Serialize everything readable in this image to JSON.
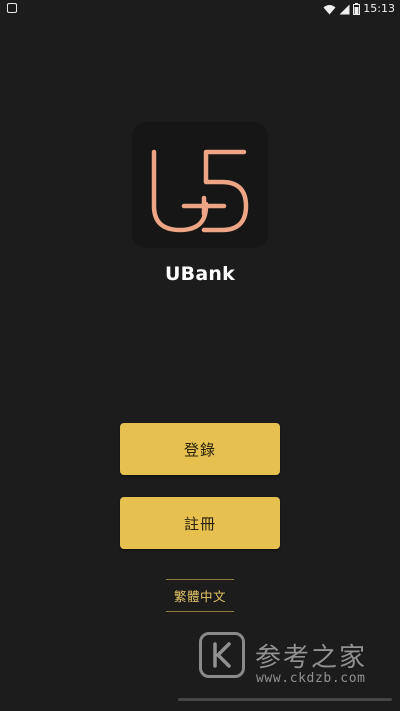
{
  "status_bar": {
    "time": "15:13",
    "icons": [
      "notification-icon",
      "wifi-icon",
      "cellular-signal-icon",
      "battery-icon"
    ]
  },
  "app": {
    "name": "UBank",
    "logo_color": "#eda585",
    "logo_icon": "ubank-logo"
  },
  "actions": {
    "login_label": "登錄",
    "register_label": "註冊",
    "language_label": "繁體中文",
    "button_color": "#e6c14f"
  },
  "watermark": {
    "title": "参考之家",
    "url": "www.ckdzb.com",
    "icon": "k-logo-icon"
  }
}
